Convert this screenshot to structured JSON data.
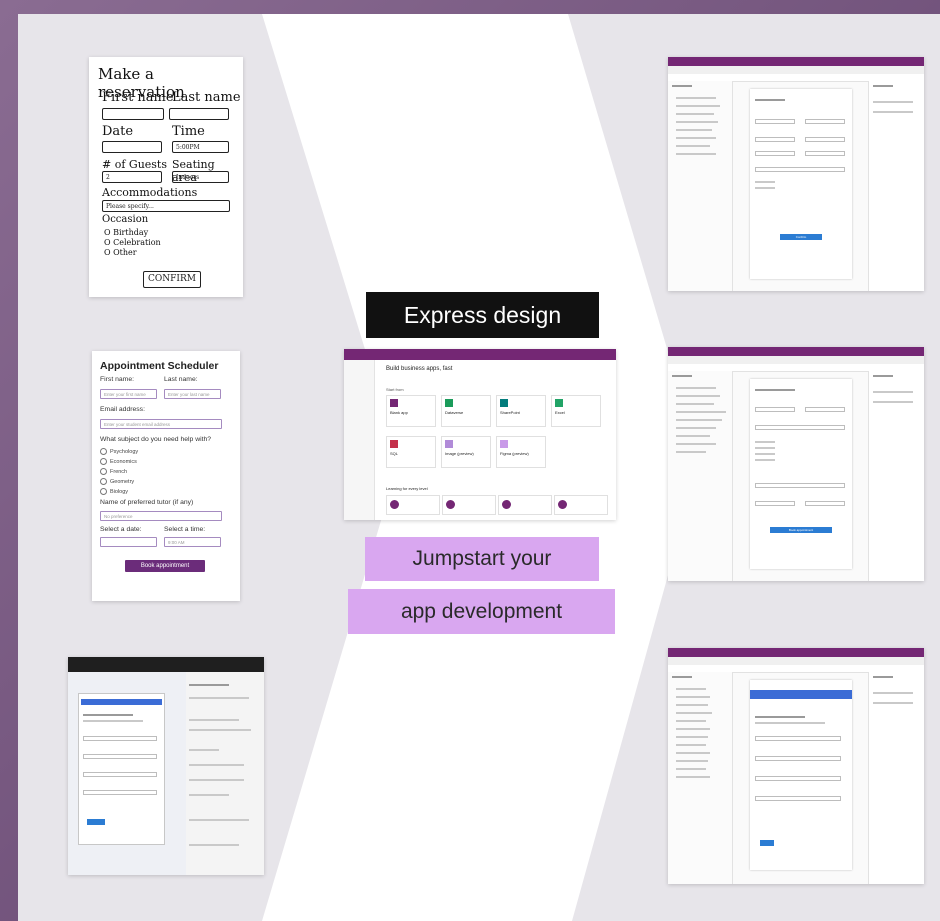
{
  "headline": "Express design",
  "subtitle_line1": "Jumpstart your",
  "subtitle_line2": "app development",
  "colors": {
    "accent_purple": "#742774",
    "callout_bg": "#d9a7f0",
    "headline_bg": "#111111",
    "primary_button": "#2b7cd3"
  },
  "sketch": {
    "title": "Make a reservation",
    "first_name": "First name",
    "last_name": "Last name",
    "date": "Date",
    "time": "Time",
    "time_value": "5:00PM",
    "guests": "# of Guests",
    "guests_value": "2",
    "seating": "Seating area",
    "seating_value": "Indoors",
    "accommodations": "Accommodations",
    "accommodations_placeholder": "Please specify...",
    "occasion": "Occasion",
    "options": [
      "O Birthday",
      "O Celebration",
      "O Other"
    ],
    "confirm": "CONFIRM"
  },
  "appointment": {
    "title": "Appointment Scheduler",
    "first_name": "First name:",
    "last_name": "Last name:",
    "first_placeholder": "Enter your first name",
    "last_placeholder": "Enter your last name",
    "email": "Email address:",
    "email_placeholder": "Enter your student email address",
    "subject_q": "What subject do you need help with?",
    "subjects": [
      "Psychology",
      "Economics",
      "French",
      "Geometry",
      "Biology"
    ],
    "tutor": "Name of preferred tutor (if any)",
    "tutor_value": "No preference",
    "date": "Select a date:",
    "time": "Select a time:",
    "time_value": "9:00 AM",
    "button": "Book appointment"
  },
  "center_app": {
    "brand": "Microsoft",
    "product": "Power Apps",
    "heading": "Build business apps, fast",
    "start_from": "Start from",
    "tiles": [
      "Blank app",
      "Dataverse",
      "SharePoint",
      "Excel",
      "SQL",
      "Image (preview)",
      "Figma (preview)"
    ],
    "learning": "Learning for every level"
  },
  "right_apps": {
    "brand": "Microsoft",
    "product": "Power Apps | Canvas",
    "tree_view": "Tree view",
    "book_button": "Book appointment",
    "confirm_button": "Confirm"
  }
}
